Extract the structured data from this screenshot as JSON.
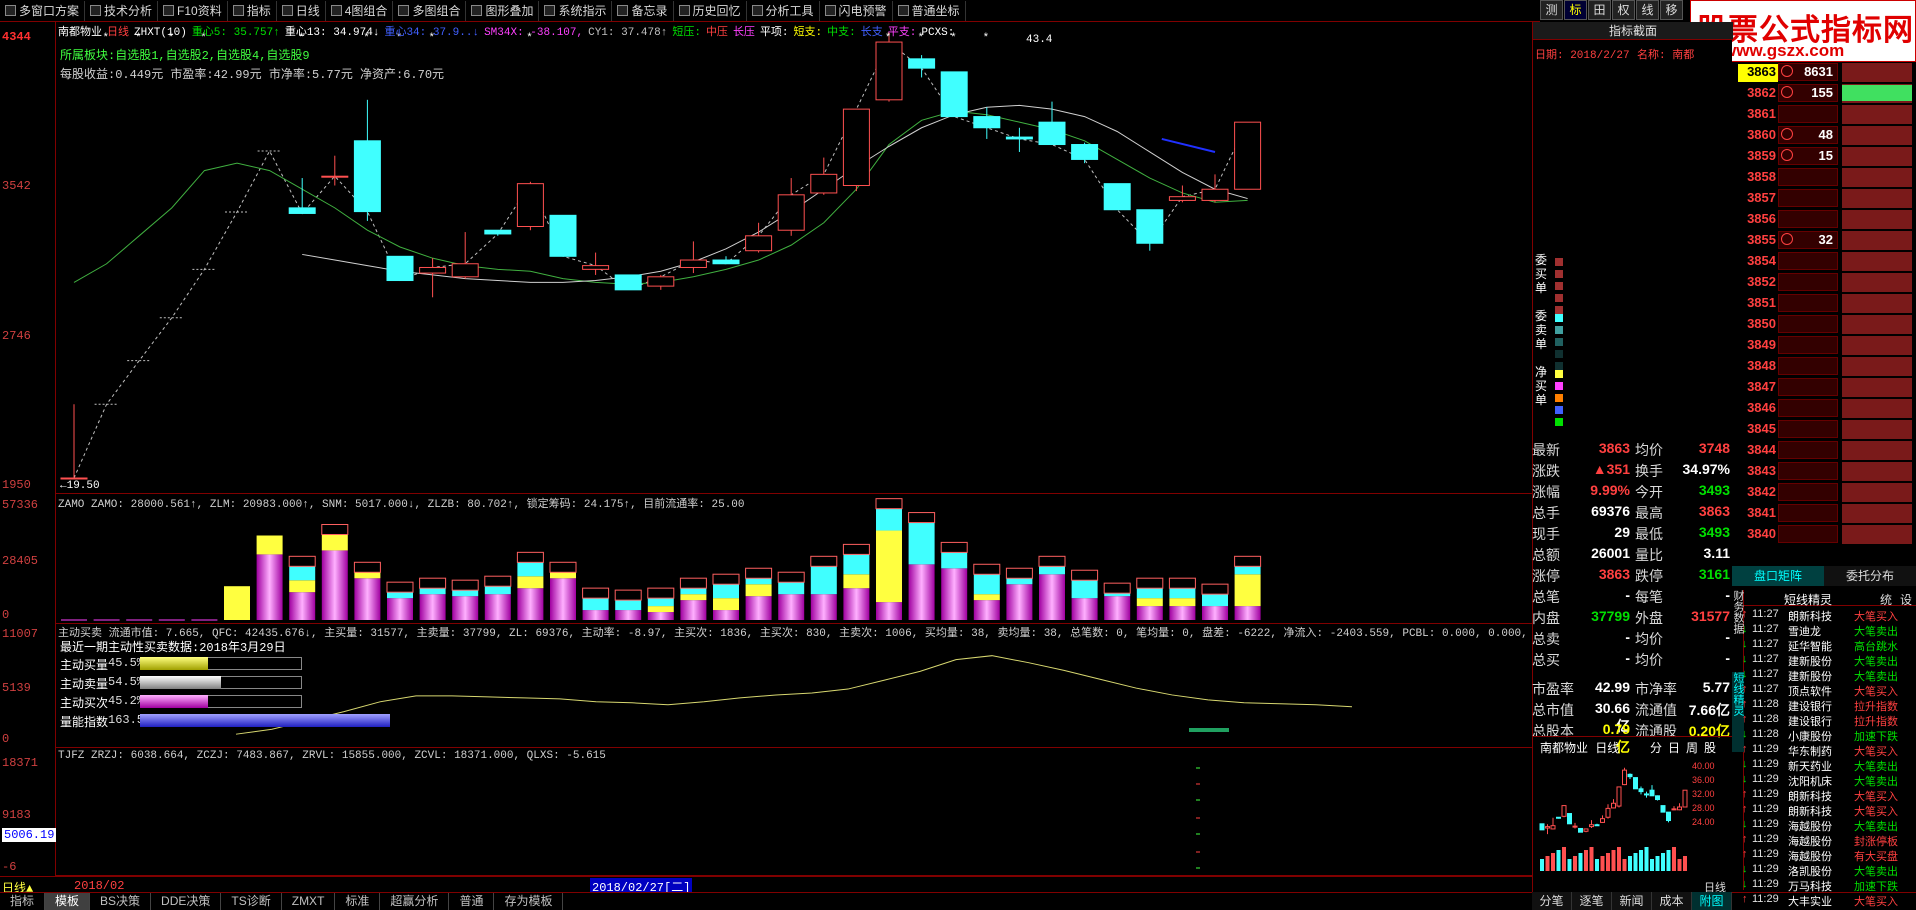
{
  "menu": [
    "多窗口方案",
    "技术分析",
    "F10资料",
    "指标",
    "日线",
    "4图组合",
    "多图组合",
    "图形叠加",
    "系统指示",
    "备忘录",
    "历史回忆",
    "分析工具",
    "闪电预警",
    "普通坐标"
  ],
  "right_tabs": [
    "测",
    "标",
    "田",
    "权",
    "线",
    "移"
  ],
  "logo": {
    "line1": "股票公式指标网",
    "line2": "www.gszx.com"
  },
  "main_header": {
    "stock": "南都物业",
    "period": "日线",
    "indicator": "ZHXT(10)",
    "line1_items": [
      {
        "t": "重心5: 35.757↑",
        "c": "green"
      },
      {
        "t": "重心13: 34.974↓",
        "c": "white"
      },
      {
        "t": "重心34: 37.9..↓",
        "c": "blue"
      },
      {
        "t": "SM34X: -38.107,",
        "c": "mag"
      },
      {
        "t": "CY1: 37.478↑",
        "c": "gray"
      },
      {
        "t": "短压:",
        "c": "green"
      },
      {
        "t": "中压",
        "c": "red"
      },
      {
        "t": "长压",
        "c": "mag"
      },
      {
        "t": "平项:",
        "c": "white"
      },
      {
        "t": "短支:",
        "c": "yellow"
      },
      {
        "t": "中支:",
        "c": "green"
      },
      {
        "t": "长支",
        "c": "blue"
      },
      {
        "t": "平支:",
        "c": "mag"
      },
      {
        "t": "PCXS:",
        "c": "white"
      }
    ],
    "line2": "所属板块:自选股1,自选股2,自选股4,自选股9",
    "line3": "每股收益:0.449元 市盈率:42.99元 市净率:5.77元 净资产:6.70元",
    "high_label": "43.4",
    "low_label": "←19.50"
  },
  "y_axis_main": [
    "4344",
    "3542",
    "2746",
    "1950"
  ],
  "y_axis_vol": [
    "57336",
    "28405",
    "0"
  ],
  "y_axis_ind": [
    "11007",
    "5139",
    "0"
  ],
  "y_axis_bot": [
    "18371",
    "9183",
    "5006.19",
    "-6"
  ],
  "vol_header": "ZAMO ZAMO: 28000.561↑, ZLM: 20983.000↑, SNM: 5017.000↓, ZLZB: 80.702↑, 锁定筹码: 24.175↑, 目前流通率: 25.00",
  "ind_header": "主动买卖 流通市值: 7.665, QFC: 42435.676↓, 主买量: 31577, 主卖量: 37799, ZL: 69376, 主动率: -8.97, 主买次: 1836, 主买次: 830, 主卖次: 1006, 买均量: 38, 卖均量: 38, 总笔数: 0, 笔均量: 0, 盘差: -6222, 净流入: -2403.559, PCBL: 0.000, 0.000, 0.000, 0.000, 0.0",
  "ind_sub": "最近一期主动性买卖数据:2018年3月29日",
  "bars": [
    {
      "label": "主动买量",
      "pct": "45.5%"
    },
    {
      "label": "主动卖量",
      "pct": "54.5%"
    },
    {
      "label": "主动买次",
      "pct": "45.2%"
    },
    {
      "label": "量能指数",
      "pct": "163.5%"
    }
  ],
  "bot_header": "TJFZ ZRZJ: 6038.664, ZCZJ: 7483.867, ZRVL: 15855.000, ZCVL: 18371.000, QLXS: -5.615",
  "date_bar": {
    "left": "日线▲",
    "y": "2018/02",
    "cur": "2018/02/27[二]"
  },
  "bottom_tabs": [
    "指标",
    "模板",
    "BS决策",
    "DDE决策",
    "TS诊断",
    "ZMXT",
    "标准",
    "超赢分析",
    "普通",
    "存为模板"
  ],
  "right_panel": {
    "title": "指标截面",
    "date_label": "日期: 2018/2/27",
    "name_label": "名称: 南都",
    "side_labels": [
      "委买单",
      "委卖单",
      "净买单"
    ]
  },
  "ladder": [
    {
      "p": "3863",
      "v": "8631",
      "hl": "yellow"
    },
    {
      "p": "3862",
      "v": "155"
    },
    {
      "p": "3861",
      "v": ""
    },
    {
      "p": "3860",
      "v": "48"
    },
    {
      "p": "3859",
      "v": "15"
    },
    {
      "p": "3858",
      "v": ""
    },
    {
      "p": "3857",
      "v": ""
    },
    {
      "p": "3856",
      "v": ""
    },
    {
      "p": "3855",
      "v": "32"
    },
    {
      "p": "3854",
      "v": ""
    },
    {
      "p": "3852",
      "v": ""
    },
    {
      "p": "3851",
      "v": ""
    },
    {
      "p": "3850",
      "v": ""
    },
    {
      "p": "3849",
      "v": ""
    },
    {
      "p": "3848",
      "v": ""
    },
    {
      "p": "3847",
      "v": ""
    },
    {
      "p": "3846",
      "v": ""
    },
    {
      "p": "3845",
      "v": ""
    },
    {
      "p": "3844",
      "v": ""
    },
    {
      "p": "3843",
      "v": ""
    },
    {
      "p": "3842",
      "v": ""
    },
    {
      "p": "3841",
      "v": ""
    },
    {
      "p": "3840",
      "v": ""
    }
  ],
  "ladder_tabs": [
    "盘口矩阵",
    "委托分布"
  ],
  "quote": [
    {
      "k": "最新",
      "v": "3863",
      "vc": "red",
      "k2": "均价",
      "v2": "3748",
      "v2c": "red"
    },
    {
      "k": "涨跌",
      "v": "▲351",
      "vc": "red",
      "k2": "换手",
      "v2": "34.97%",
      "v2c": "white"
    },
    {
      "k": "涨幅",
      "v": "9.99%",
      "vc": "red",
      "k2": "今开",
      "v2": "3493",
      "v2c": "green"
    },
    {
      "k": "总手",
      "v": "69376",
      "vc": "white",
      "k2": "最高",
      "v2": "3863",
      "v2c": "red"
    },
    {
      "k": "现手",
      "v": "29",
      "vc": "white",
      "k2": "最低",
      "v2": "3493",
      "v2c": "green"
    },
    {
      "k": "总额",
      "v": "26001",
      "vc": "white",
      "k2": "量比",
      "v2": "3.11",
      "v2c": "white"
    },
    {
      "k": "涨停",
      "v": "3863",
      "vc": "red",
      "k2": "跌停",
      "v2": "3161",
      "v2c": "green"
    },
    {
      "k": "总笔",
      "v": "-",
      "vc": "white",
      "k2": "每笔",
      "v2": "-",
      "v2c": "white"
    },
    {
      "k": "内盘",
      "v": "37799",
      "vc": "green",
      "k2": "外盘",
      "v2": "31577",
      "v2c": "red"
    },
    {
      "k": "总卖",
      "v": "-",
      "vc": "white",
      "k2": "均价",
      "v2": "-",
      "v2c": "white"
    },
    {
      "k": "总买",
      "v": "-",
      "vc": "white",
      "k2": "均价",
      "v2": "-",
      "v2c": "white"
    },
    {
      "k": "市盈率",
      "v": "42.99",
      "vc": "white",
      "k2": "市净率",
      "v2": "5.77",
      "v2c": "white"
    },
    {
      "k": "总市值",
      "v": "30.66亿",
      "vc": "white",
      "k2": "流通值",
      "v2": "7.66亿",
      "v2c": "white"
    },
    {
      "k": "总股本",
      "v": "0.79亿",
      "vc": "yellow",
      "k2": "流通股",
      "v2": "0.20亿",
      "v2c": "yellow"
    }
  ],
  "side_tabs": [
    "财务数据",
    "短线精灵"
  ],
  "mini_chart": {
    "title": "南都物业 日线",
    "tabs": [
      "分",
      "日",
      "周",
      "股"
    ],
    "ticks": [
      "40.00",
      "36.00",
      "32.00",
      "28.00",
      "24.00"
    ],
    "label": "日线"
  },
  "mini_tabs": [
    "分笔",
    "逐笔",
    "新闻",
    "成本",
    "附图"
  ],
  "elf": {
    "title": "短线精灵",
    "tabs": [
      "统",
      "设"
    ],
    "items": [
      {
        "t": "11:27",
        "n": "朗新科技",
        "a": "大笔买入",
        "ac": "red",
        "d": "up"
      },
      {
        "t": "11:27",
        "n": "雪迪龙",
        "a": "大笔卖出",
        "ac": "green",
        "d": "down"
      },
      {
        "t": "11:27",
        "n": "延华智能",
        "a": "高台跳水",
        "ac": "green",
        "d": "down"
      },
      {
        "t": "11:27",
        "n": "建新股份",
        "a": "大笔卖出",
        "ac": "green",
        "d": "down"
      },
      {
        "t": "11:27",
        "n": "建新股份",
        "a": "大笔卖出",
        "ac": "green",
        "d": "down"
      },
      {
        "t": "11:27",
        "n": "顶点软件",
        "a": "大笔买入",
        "ac": "red",
        "d": "up"
      },
      {
        "t": "11:28",
        "n": "建设银行",
        "a": "拉升指数",
        "ac": "red",
        "d": "up"
      },
      {
        "t": "11:28",
        "n": "建设银行",
        "a": "拉升指数",
        "ac": "red",
        "d": "up"
      },
      {
        "t": "11:28",
        "n": "小康股份",
        "a": "加速下跌",
        "ac": "green",
        "d": "down"
      },
      {
        "t": "11:29",
        "n": "华东制药",
        "a": "大笔买入",
        "ac": "red",
        "d": "up"
      },
      {
        "t": "11:29",
        "n": "新天药业",
        "a": "大笔卖出",
        "ac": "green",
        "d": "down"
      },
      {
        "t": "11:29",
        "n": "沈阳机床",
        "a": "大笔卖出",
        "ac": "green",
        "d": "down"
      },
      {
        "t": "11:29",
        "n": "朗新科技",
        "a": "大笔买入",
        "ac": "red",
        "d": "up"
      },
      {
        "t": "11:29",
        "n": "朗新科技",
        "a": "大笔买入",
        "ac": "red",
        "d": "up"
      },
      {
        "t": "11:29",
        "n": "海越股份",
        "a": "大笔卖出",
        "ac": "green",
        "d": "down"
      },
      {
        "t": "11:29",
        "n": "海越股份",
        "a": "封涨停板",
        "ac": "red",
        "d": "up"
      },
      {
        "t": "11:29",
        "n": "海越股份",
        "a": "有大买盘",
        "ac": "red",
        "d": "up"
      },
      {
        "t": "11:29",
        "n": "洛凯股份",
        "a": "大笔卖出",
        "ac": "green",
        "d": "down"
      },
      {
        "t": "11:29",
        "n": "万马科技",
        "a": "加速下跌",
        "ac": "green",
        "d": "down"
      },
      {
        "t": "11:29",
        "n": "大丰实业",
        "a": "大笔买入",
        "ac": "red",
        "d": "up"
      }
    ]
  },
  "candles": [
    [
      1950,
      1950,
      2346,
      1950
    ],
    [
      2346,
      2346,
      2346,
      2346
    ],
    [
      2580,
      2580,
      2580,
      2580
    ],
    [
      2810,
      2810,
      2810,
      2810
    ],
    [
      3070,
      3070,
      3070,
      3070
    ],
    [
      3378,
      3378,
      3378,
      3378
    ],
    [
      3705,
      3705,
      3705,
      3705
    ],
    [
      3400,
      3370,
      3560,
      3370
    ],
    [
      3570,
      3570,
      3680,
      3520
    ],
    [
      3760,
      3380,
      3980,
      3330
    ],
    [
      3140,
      3010,
      3140,
      3010
    ],
    [
      3050,
      3080,
      3130,
      2920
    ],
    [
      3030,
      3100,
      3270,
      3020
    ],
    [
      3280,
      3260,
      3260,
      3250
    ],
    [
      3300,
      3530,
      3540,
      3280
    ],
    [
      3360,
      3140,
      3360,
      3140
    ],
    [
      3070,
      3090,
      3160,
      3040
    ],
    [
      3040,
      2960,
      3040,
      2960
    ],
    [
      2980,
      3030,
      3040,
      2960
    ],
    [
      3080,
      3120,
      3220,
      3050
    ],
    [
      3120,
      3100,
      3140,
      3100
    ],
    [
      3170,
      3250,
      3320,
      3160
    ],
    [
      3280,
      3470,
      3560,
      3250
    ],
    [
      3480,
      3580,
      3670,
      3470
    ],
    [
      3520,
      3930,
      3930,
      3490
    ],
    [
      3980,
      4290,
      4340,
      3970
    ],
    [
      4200,
      4150,
      4220,
      4100
    ],
    [
      4130,
      3890,
      4130,
      3890
    ],
    [
      3890,
      3830,
      3940,
      3770
    ],
    [
      3780,
      3770,
      3830,
      3700
    ],
    [
      3860,
      3740,
      3970,
      3740
    ],
    [
      3740,
      3660,
      3750,
      3640
    ],
    [
      3530,
      3390,
      3530,
      3390
    ],
    [
      3390,
      3210,
      3390,
      3170
    ],
    [
      3440,
      3460,
      3520,
      3430
    ],
    [
      3440,
      3500,
      3580,
      3430
    ],
    [
      3500,
      3860,
      3860,
      3500
    ]
  ],
  "volumes": [
    [
      0,
      0,
      0
    ],
    [
      0,
      0,
      0
    ],
    [
      0,
      0,
      0
    ],
    [
      0,
      0,
      0
    ],
    [
      0,
      0,
      0
    ],
    [
      0,
      17000,
      0
    ],
    [
      33000,
      9500,
      0
    ],
    [
      14000,
      6000,
      7000
    ],
    [
      35000,
      8000,
      0
    ],
    [
      21000,
      3000,
      0
    ],
    [
      11000,
      0,
      3000
    ],
    [
      13000,
      0,
      3000
    ],
    [
      12000,
      0,
      3000
    ],
    [
      13000,
      0,
      4000
    ],
    [
      16000,
      6000,
      7000
    ],
    [
      21000,
      3000,
      0
    ],
    [
      5000,
      0,
      6000
    ],
    [
      5000,
      0,
      5000
    ],
    [
      4000,
      3000,
      4000
    ],
    [
      10000,
      3000,
      3000
    ],
    [
      5000,
      6000,
      7000
    ],
    [
      12000,
      6000,
      3000
    ],
    [
      13000,
      0,
      6000
    ],
    [
      13000,
      0,
      14000
    ],
    [
      16000,
      7000,
      10000
    ],
    [
      9000,
      36000,
      11000
    ],
    [
      28000,
      0,
      21000
    ],
    [
      26000,
      0,
      8000
    ],
    [
      10000,
      3000,
      10000
    ],
    [
      18000,
      0,
      3000
    ],
    [
      23000,
      0,
      4000
    ],
    [
      11000,
      0,
      9000
    ],
    [
      12000,
      0,
      1500
    ],
    [
      7000,
      4000,
      5000
    ],
    [
      7000,
      4000,
      5000
    ],
    [
      7000,
      0,
      6000
    ],
    [
      7000,
      16000,
      4000
    ]
  ],
  "ma_green": [
    3000,
    3100,
    3250,
    3400,
    3600,
    3640,
    3600,
    3500,
    3400,
    3280,
    3190,
    3130,
    3090,
    3070,
    3060,
    3020,
    3000,
    2990,
    3000,
    3030,
    3070,
    3120,
    3200,
    3320,
    3500,
    3740,
    3870,
    3920,
    3900,
    3860,
    3820,
    3760,
    3660,
    3560,
    3480,
    3430,
    3440
  ],
  "ma_white": [
    3150,
    3120,
    3090,
    3060,
    3040,
    3020,
    3010,
    3000,
    3000,
    3010,
    3030,
    3060,
    3110,
    3180,
    3270,
    3380,
    3500,
    3620,
    3730,
    3830,
    3900,
    3940,
    3950,
    3930,
    3890,
    3810,
    3700,
    3590,
    3500,
    3450
  ],
  "ind_line": [
    1000,
    1500,
    2400,
    3300,
    4300,
    4900,
    4900,
    4800,
    4700,
    4600,
    4300,
    4200,
    4000,
    4300,
    4700,
    5000,
    5200,
    5600,
    6500,
    7400,
    8600,
    9000,
    8300,
    7500,
    6600,
    5700,
    5000,
    4500,
    4200,
    4100,
    4000,
    3800
  ]
}
